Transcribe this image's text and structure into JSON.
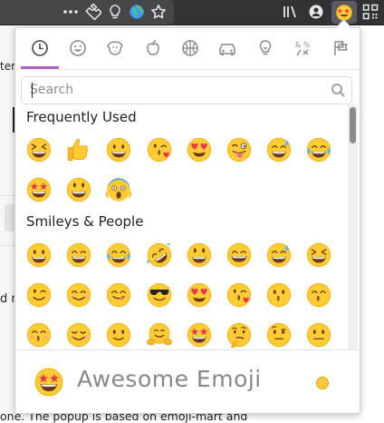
{
  "colors": {
    "toolbar_bg": "#323234",
    "category_accent": "#ae65c5",
    "emoji_face": "#ffcc33"
  },
  "toolbar": {
    "icons": [
      "more-icon",
      "extension-icon",
      "lightbulb-icon",
      "globe-icon",
      "star-icon",
      "library-icon",
      "account-icon",
      "star-struck-emoji-icon",
      "qr-code-icon"
    ]
  },
  "page": {
    "frag_top": "ter",
    "frag_mid": "d n",
    "frag_bottom": "one. The popup is based on emoji-mart and"
  },
  "categories": [
    {
      "name": "Frequently Used",
      "icon": "clock-icon",
      "active": true
    },
    {
      "name": "Smileys & People",
      "icon": "smiley-icon",
      "active": false
    },
    {
      "name": "Animals & Nature",
      "icon": "dog-icon",
      "active": false
    },
    {
      "name": "Food & Drink",
      "icon": "apple-icon",
      "active": false
    },
    {
      "name": "Activity",
      "icon": "basketball-icon",
      "active": false
    },
    {
      "name": "Travel & Places",
      "icon": "car-icon",
      "active": false
    },
    {
      "name": "Objects",
      "icon": "lightbulb-icon",
      "active": false
    },
    {
      "name": "Symbols",
      "icon": "symbols-icon",
      "active": false
    },
    {
      "name": "Flags",
      "icon": "flag-icon",
      "active": false
    }
  ],
  "search": {
    "placeholder": "Search",
    "value": ""
  },
  "sections": [
    {
      "title": "Frequently Used",
      "emojis": [
        "laughing",
        "thumbs-up",
        "grinning",
        "face-blowing-kiss",
        "heart-eyes",
        "winking-tongue",
        "grinning-sweat",
        "tears-of-joy",
        "star-struck",
        "smiley",
        "screaming"
      ]
    },
    {
      "title": "Smileys & People",
      "emojis": [
        "grinning",
        "beaming",
        "tears-of-joy",
        "rofl",
        "smiley",
        "grinning-squinting-eyes",
        "grinning-sweat",
        "laughing",
        "winking",
        "smiling-eyes",
        "yum",
        "sunglasses",
        "heart-eyes",
        "face-blowing-kiss",
        "kissing",
        "kissing-smiling-eyes",
        "kissing-closed-eyes",
        "relaxed",
        "slightly-smiling",
        "hugging",
        "star-struck",
        "thinking",
        "raised-eyebrow",
        "neutral"
      ]
    }
  ],
  "preview": {
    "title": "Awesome Emoji",
    "emoji": "star-struck",
    "skin_tone": "default"
  }
}
